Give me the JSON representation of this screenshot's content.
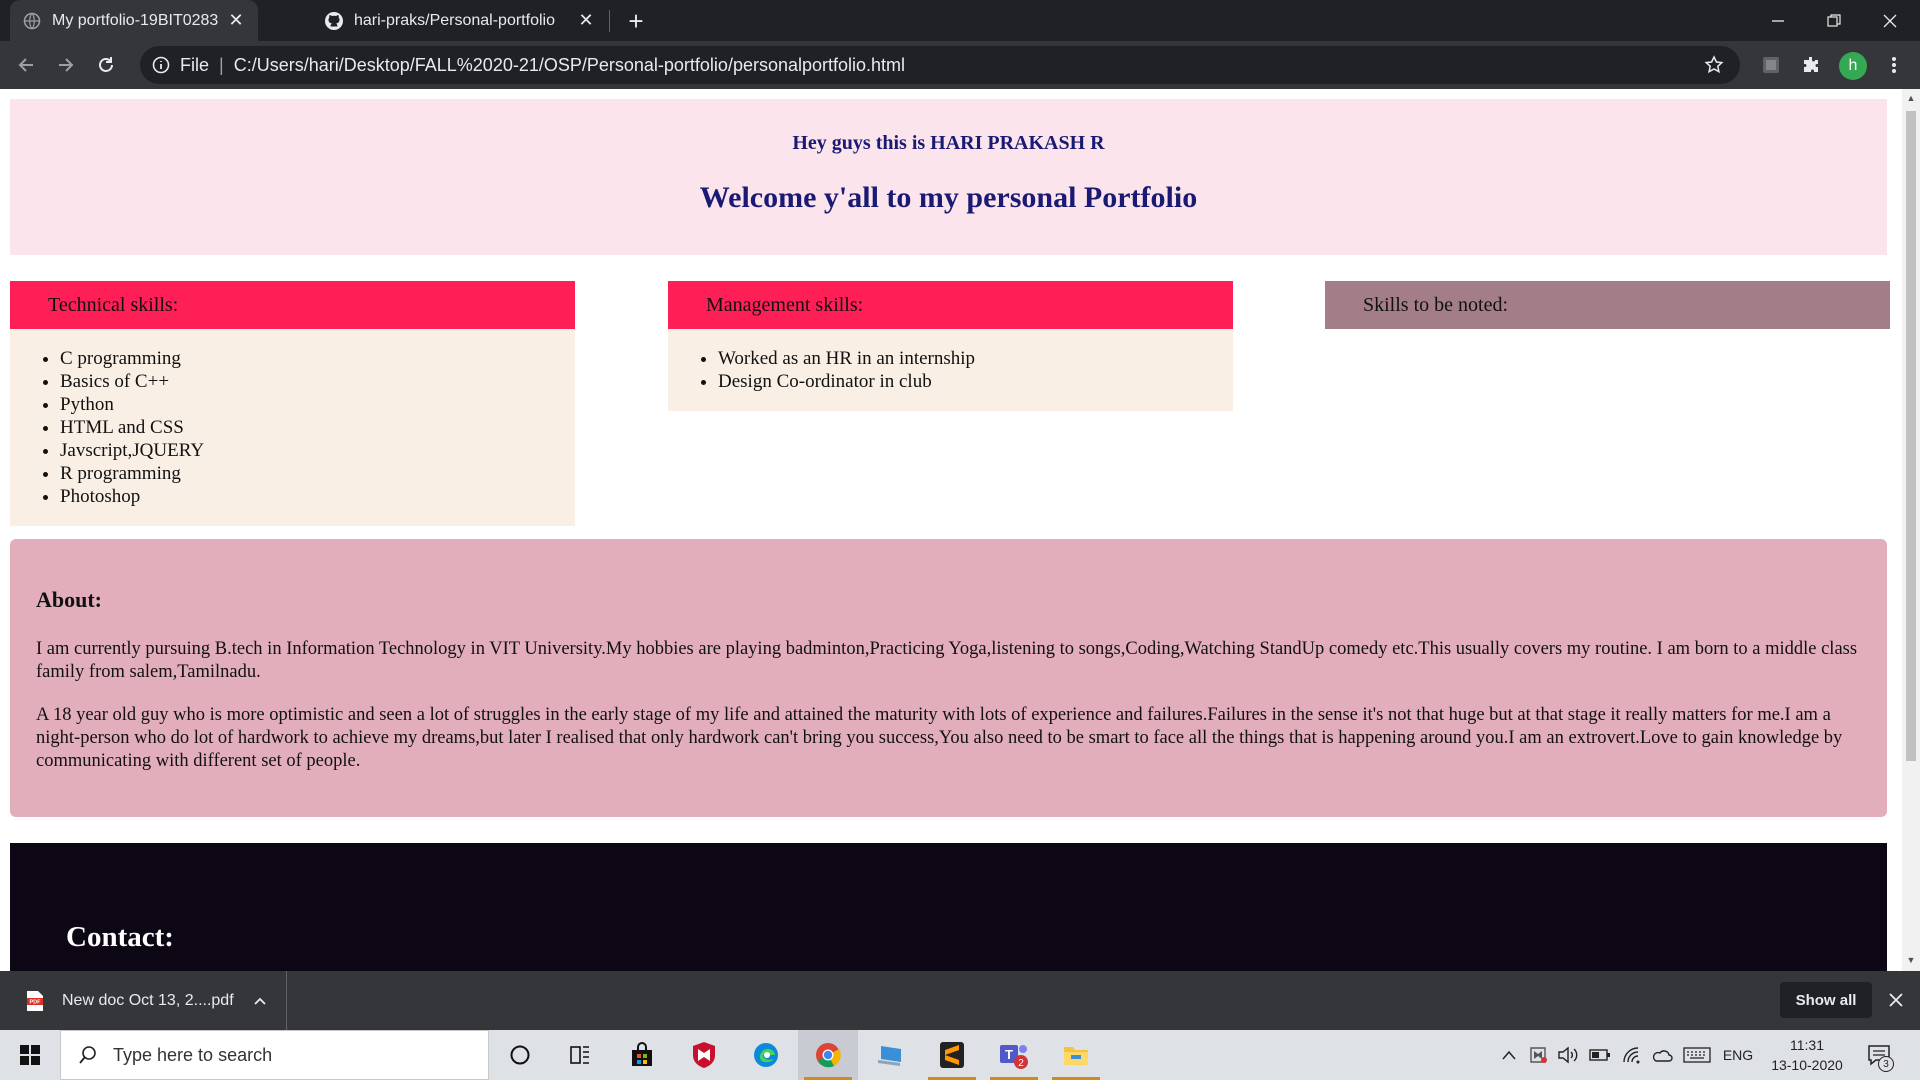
{
  "browser": {
    "tabs": [
      {
        "title": "My portfolio-19BIT0283",
        "active": true
      },
      {
        "title": "hari-praks/Personal-portfolio",
        "active": false
      }
    ],
    "address": {
      "scheme_label": "File",
      "url": "C:/Users/hari/Desktop/FALL%2020-21/OSP/Personal-portfolio/personalportfolio.html"
    },
    "profile_initial": "h"
  },
  "page": {
    "header": {
      "greeting": "Hey guys this is HARI PRAKASH R",
      "welcome": "Welcome y'all to my personal Portfolio"
    },
    "cards": [
      {
        "heading": "Technical skills:",
        "header_color": "#ff1f57",
        "items": [
          "C programming",
          "Basics of C++",
          "Python",
          "HTML and CSS",
          "Javscript,JQUERY",
          "R programming",
          "Photoshop"
        ]
      },
      {
        "heading": "Management skills:",
        "header_color": "#ff1f57",
        "items": [
          "Worked as an HR in an internship",
          "Design Co-ordinator in club"
        ]
      },
      {
        "heading": "Skills to be noted:",
        "header_color": "#a37e89",
        "items": []
      }
    ],
    "about": {
      "heading": "About:",
      "paragraphs": [
        "I am currently pursuing B.tech in Information Technology in VIT University.My hobbies are playing badminton,Practicing Yoga,listening to songs,Coding,Watching StandUp comedy etc.This usually covers my routine. I am born to a middle class family from salem,Tamilnadu.",
        "A 18 year old guy who is more optimistic and seen a lot of struggles in the early stage of my life and attained the maturity with lots of experience and failures.Failures in the sense it's not that huge but at that stage it really matters for me.I am a night-person who do lot of hardwork to achieve my dreams,but later I realised that only hardwork can't bring you success,You also need to be smart to face all the things that is happening around you.I am an extrovert.Love to gain knowledge by communicating with different set of people."
      ]
    },
    "contact": {
      "heading": "Contact:"
    }
  },
  "downloads": {
    "file_name": "New doc Oct 13, 2....pdf",
    "show_all_label": "Show all"
  },
  "taskbar": {
    "search_placeholder": "Type here to search",
    "language": "ENG",
    "time": "11:31",
    "date": "13-10-2020",
    "teams_badge": "2",
    "notification_count": "3"
  }
}
